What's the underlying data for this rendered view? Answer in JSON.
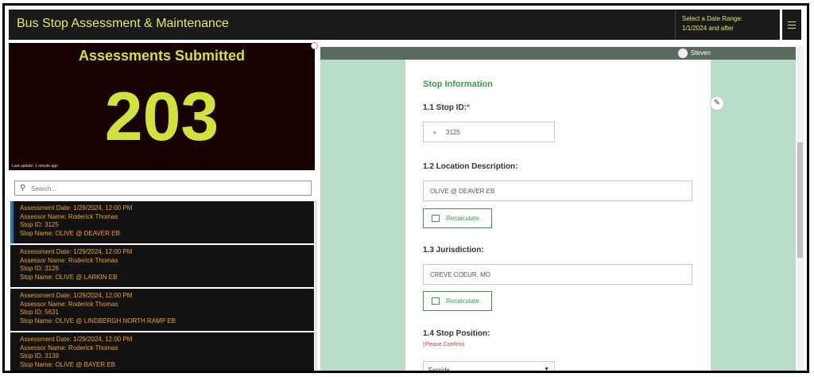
{
  "header": {
    "title": "Bus Stop Assessment & Maintenance",
    "date_range_label": "Select a Date Range:",
    "date_range_value": "1/1/2024 and after"
  },
  "kpi": {
    "title": "Assessments Submitted",
    "value": "203",
    "last_update": "Last update: 1 minute ago"
  },
  "search": {
    "placeholder": "Search..."
  },
  "list_labels": {
    "date": "Assessment Date:",
    "assessor": "Assessor Name:",
    "stop_id": "Stop ID:",
    "stop_name": "Stop Name:"
  },
  "list": [
    {
      "date": "1/29/2024, 12:00 PM",
      "assessor": "Roderick Thomas",
      "stop_id": "3125",
      "stop_name": "OLIVE @ DEAVER EB"
    },
    {
      "date": "1/29/2024, 12:00 PM",
      "assessor": "Roderick Thomas",
      "stop_id": "3126",
      "stop_name": "OLIVE @ LARKIN EB"
    },
    {
      "date": "1/29/2024, 12:00 PM",
      "assessor": "Roderick Thomas",
      "stop_id": "5631",
      "stop_name": "OLIVE @ LINDBERGH NORTH RAMP EB"
    },
    {
      "date": "1/29/2024, 12:00 PM",
      "assessor": "Roderick Thomas",
      "stop_id": "3139",
      "stop_name": "OLIVE @ BAYER EB"
    }
  ],
  "user": {
    "name": "Steven"
  },
  "form": {
    "section_title": "Stop Information",
    "stop_id_label": "1.1 Stop ID:",
    "stop_id_required": "*",
    "stop_id_value": "3125",
    "location_label": "1.2 Location Description:",
    "location_value": "OLIVE @ DEAVER EB",
    "recalc_label": "Recalculate",
    "jurisdiction_label": "1.3 Jurisdiction:",
    "jurisdiction_value": "CREVE COEUR, MO",
    "position_label": "1.4 Stop Position:",
    "position_note": "(Please Confirm)",
    "position_value": "Farside"
  },
  "colors": {
    "header_bg": "#1a1a1a",
    "accent_yellow": "#cfe33a",
    "list_text": "#f0a21e",
    "form_green": "#3c9a4a",
    "panel_green": "#b8dcc6"
  }
}
